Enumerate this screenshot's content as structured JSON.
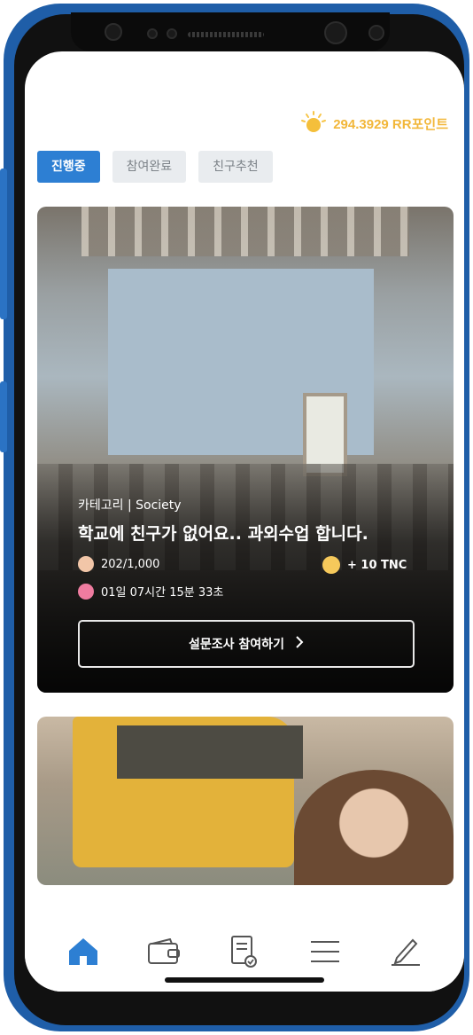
{
  "header": {
    "points_text": "294.3929 RR포인트",
    "points_icon": "sun-coin-icon",
    "accent_color": "#f2b73a"
  },
  "tabs": [
    {
      "label": "진행중",
      "active": true
    },
    {
      "label": "참여완료",
      "active": false
    },
    {
      "label": "친구추천",
      "active": false
    }
  ],
  "survey_card": {
    "category": "카테고리 | Society",
    "title": "학교에 친구가 없어요.. 과외수업 합니다.",
    "participants": "202/1,000",
    "reward": "+ 10 TNC",
    "time_left": "01일 07시간 15분 33초",
    "cta_label": "설문조사 참여하기"
  },
  "bottom_nav": [
    {
      "icon": "home-icon",
      "active": true
    },
    {
      "icon": "wallet-icon",
      "active": false
    },
    {
      "icon": "document-check-icon",
      "active": false
    },
    {
      "icon": "menu-icon",
      "active": false
    },
    {
      "icon": "pencil-icon",
      "active": false
    }
  ],
  "colors": {
    "primary": "#2d7fd3",
    "tab_inactive_bg": "#e9ecef"
  }
}
